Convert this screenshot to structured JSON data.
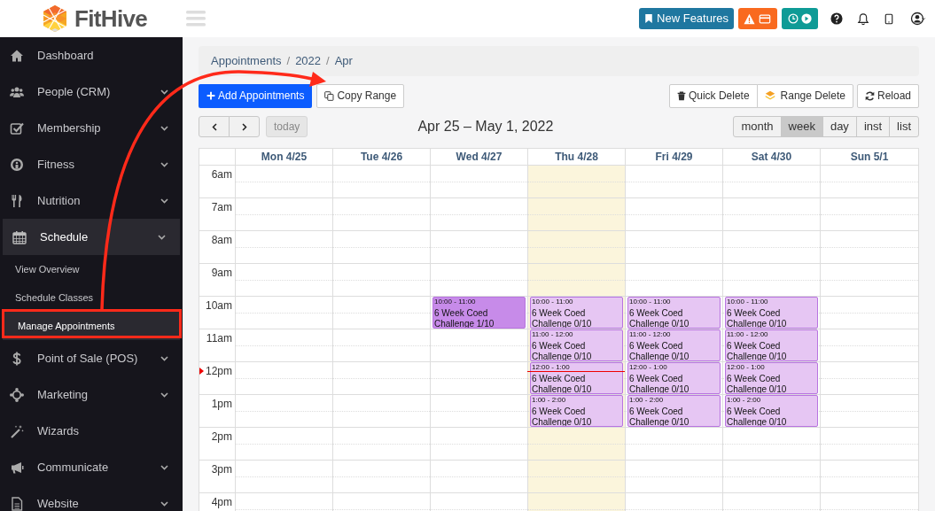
{
  "app": {
    "logo_text": "FitHive"
  },
  "header": {
    "new_features": "New Features"
  },
  "sidebar": {
    "items": [
      {
        "label": "Dashboard",
        "expandable": false,
        "expanded": false
      },
      {
        "label": "People (CRM)",
        "expandable": true,
        "expanded": false
      },
      {
        "label": "Membership",
        "expandable": true,
        "expanded": false
      },
      {
        "label": "Fitness",
        "expandable": true,
        "expanded": false
      },
      {
        "label": "Nutrition",
        "expandable": true,
        "expanded": false
      },
      {
        "label": "Schedule",
        "expandable": true,
        "expanded": true,
        "children": [
          {
            "label": "View Overview",
            "selected": false
          },
          {
            "label": "Schedule Classes",
            "selected": false
          },
          {
            "label": "Manage Appointments",
            "selected": true
          }
        ]
      },
      {
        "label": "Point of Sale (POS)",
        "expandable": true,
        "expanded": false
      },
      {
        "label": "Marketing",
        "expandable": true,
        "expanded": false
      },
      {
        "label": "Wizards",
        "expandable": false,
        "expanded": false
      },
      {
        "label": "Communicate",
        "expandable": true,
        "expanded": false
      },
      {
        "label": "Website",
        "expandable": true,
        "expanded": false
      }
    ]
  },
  "breadcrumb": {
    "separator": "/",
    "items": [
      "Appointments",
      "2022",
      "Apr"
    ]
  },
  "toolbar": {
    "add": "Add Appointments",
    "copy": "Copy Range",
    "quick_delete": "Quick Delete",
    "range_delete": "Range Delete",
    "reload": "Reload"
  },
  "nav": {
    "today": "today",
    "today_disabled": true,
    "title": "Apr 25 – May 1, 2022"
  },
  "views": [
    {
      "label": "month",
      "selected": false
    },
    {
      "label": "week",
      "selected": true
    },
    {
      "label": "day",
      "selected": false
    },
    {
      "label": "inst",
      "selected": false
    },
    {
      "label": "list",
      "selected": false
    }
  ],
  "calendar": {
    "days": [
      {
        "label": "Mon 4/25",
        "today": false
      },
      {
        "label": "Tue 4/26",
        "today": false
      },
      {
        "label": "Wed 4/27",
        "today": false
      },
      {
        "label": "Thu 4/28",
        "today": true
      },
      {
        "label": "Fri 4/29",
        "today": false
      },
      {
        "label": "Sat 4/30",
        "today": false
      },
      {
        "label": "Sun 5/1",
        "today": false
      }
    ],
    "rows": [
      {
        "label": "6am",
        "cells": [
          null,
          null,
          null,
          null,
          null,
          null,
          null
        ]
      },
      {
        "label": "7am",
        "cells": [
          null,
          null,
          null,
          null,
          null,
          null,
          null
        ]
      },
      {
        "label": "8am",
        "cells": [
          null,
          null,
          null,
          null,
          null,
          null,
          null
        ]
      },
      {
        "label": "9am",
        "cells": [
          null,
          null,
          null,
          null,
          null,
          null,
          null
        ]
      },
      {
        "label": "10am",
        "cells": [
          null,
          null,
          {
            "time": "10:00 - 11:00",
            "title": "6 Week Coed Challenge 1/10",
            "color": "#c78be9"
          },
          {
            "time": "10:00 - 11:00",
            "title": "6 Week Coed Challenge 0/10",
            "color": "#e6c6f3"
          },
          {
            "time": "10:00 - 11:00",
            "title": "6 Week Coed Challenge 0/10",
            "color": "#e6c6f3"
          },
          {
            "time": "10:00 - 11:00",
            "title": "6 Week Coed Challenge 0/10",
            "color": "#e6c6f3"
          },
          null
        ]
      },
      {
        "label": "11am",
        "cells": [
          null,
          null,
          null,
          {
            "time": "11:00 - 12:00",
            "title": "6 Week Coed Challenge 0/10",
            "color": "#e6c6f3"
          },
          {
            "time": "11:00 - 12:00",
            "title": "6 Week Coed Challenge 0/10",
            "color": "#e6c6f3"
          },
          {
            "time": "11:00 - 12:00",
            "title": "6 Week Coed Challenge 0/10",
            "color": "#e6c6f3"
          },
          null
        ]
      },
      {
        "label": "12pm",
        "cells": [
          null,
          null,
          null,
          {
            "time": "12:00 - 1:00",
            "title": "6 Week Coed Challenge 0/10",
            "color": "#e6c6f3"
          },
          {
            "time": "12:00 - 1:00",
            "title": "6 Week Coed Challenge 0/10",
            "color": "#e6c6f3"
          },
          {
            "time": "12:00 - 1:00",
            "title": "6 Week Coed Challenge 0/10",
            "color": "#e6c6f3"
          },
          null
        ]
      },
      {
        "label": "1pm",
        "cells": [
          null,
          null,
          null,
          {
            "time": "1:00 - 2:00",
            "title": "6 Week Coed Challenge 0/10",
            "color": "#e6c6f3"
          },
          {
            "time": "1:00 - 2:00",
            "title": "6 Week Coed Challenge 0/10",
            "color": "#e6c6f3"
          },
          {
            "time": "1:00 - 2:00",
            "title": "6 Week Coed Challenge 0/10",
            "color": "#e6c6f3"
          },
          null
        ]
      },
      {
        "label": "2pm",
        "cells": [
          null,
          null,
          null,
          null,
          null,
          null,
          null
        ]
      },
      {
        "label": "3pm",
        "cells": [
          null,
          null,
          null,
          null,
          null,
          null,
          null
        ]
      },
      {
        "label": "4pm",
        "cells": [
          null,
          null,
          null,
          null,
          null,
          null,
          null
        ]
      }
    ]
  },
  "annotations": {
    "highlight_box": true,
    "arrow": true
  }
}
